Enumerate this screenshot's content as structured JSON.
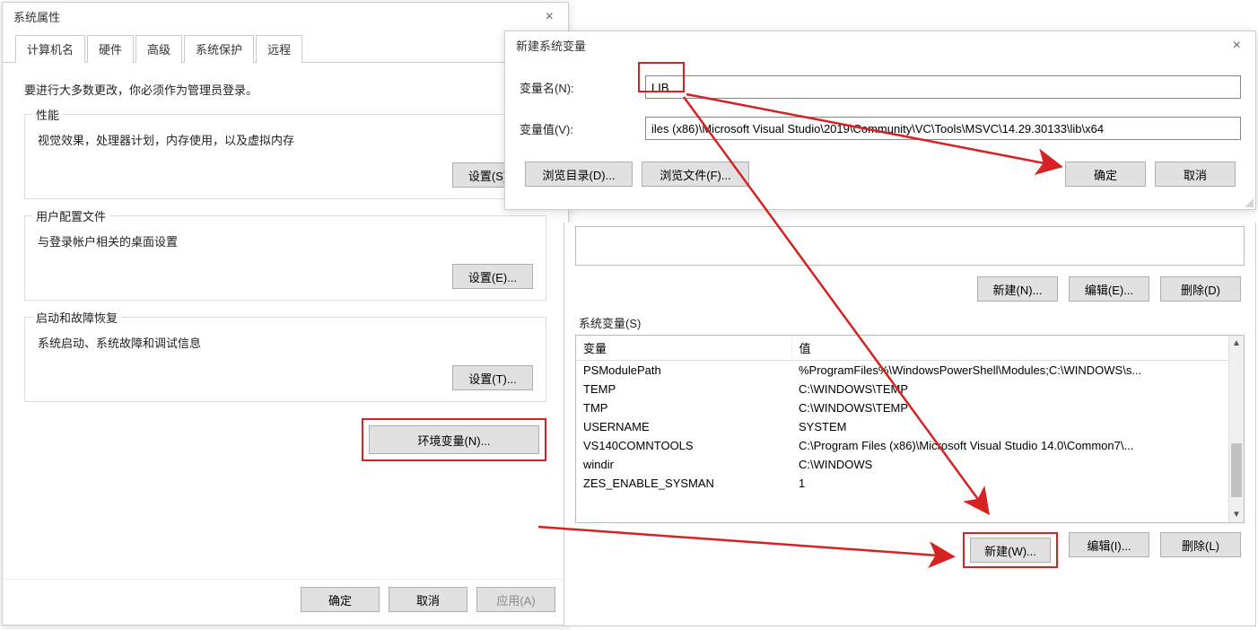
{
  "sysprops": {
    "title": "系统属性",
    "tabs": [
      "计算机名",
      "硬件",
      "高级",
      "系统保护",
      "远程"
    ],
    "active_tab_index": 2,
    "admin_note": "要进行大多数更改，你必须作为管理员登录。",
    "perf": {
      "legend": "性能",
      "desc": "视觉效果，处理器计划，内存使用，以及虚拟内存",
      "btn": "设置(S)..."
    },
    "profiles": {
      "legend": "用户配置文件",
      "desc": "与登录帐户相关的桌面设置",
      "btn": "设置(E)..."
    },
    "startup": {
      "legend": "启动和故障恢复",
      "desc": "系统启动、系统故障和调试信息",
      "btn": "设置(T)..."
    },
    "envvar_btn": "环境变量(N)...",
    "ok": "确定",
    "cancel": "取消",
    "apply": "应用(A)"
  },
  "envvars": {
    "user_new": "新建(N)...",
    "user_edit": "编辑(E)...",
    "user_del": "删除(D)",
    "section_label": "系统变量(S)",
    "col_var": "变量",
    "col_val": "值",
    "rows": [
      {
        "name": "PSModulePath",
        "value": "%ProgramFiles%\\WindowsPowerShell\\Modules;C:\\WINDOWS\\s..."
      },
      {
        "name": "TEMP",
        "value": "C:\\WINDOWS\\TEMP"
      },
      {
        "name": "TMP",
        "value": "C:\\WINDOWS\\TEMP"
      },
      {
        "name": "USERNAME",
        "value": "SYSTEM"
      },
      {
        "name": "VS140COMNTOOLS",
        "value": "C:\\Program Files (x86)\\Microsoft Visual Studio 14.0\\Common7\\..."
      },
      {
        "name": "windir",
        "value": "C:\\WINDOWS"
      },
      {
        "name": "ZES_ENABLE_SYSMAN",
        "value": "1"
      }
    ],
    "sys_new": "新建(W)...",
    "sys_edit": "编辑(I)...",
    "sys_del": "删除(L)"
  },
  "newvar": {
    "title": "新建系统变量",
    "name_label": "变量名(N):",
    "name_value": "LIB",
    "value_label": "变量值(V):",
    "value_value": "iles (x86)\\Microsoft Visual Studio\\2019\\Community\\VC\\Tools\\MSVC\\14.29.30133\\lib\\x64",
    "browse_dir": "浏览目录(D)...",
    "browse_file": "浏览文件(F)...",
    "ok": "确定",
    "cancel": "取消"
  }
}
